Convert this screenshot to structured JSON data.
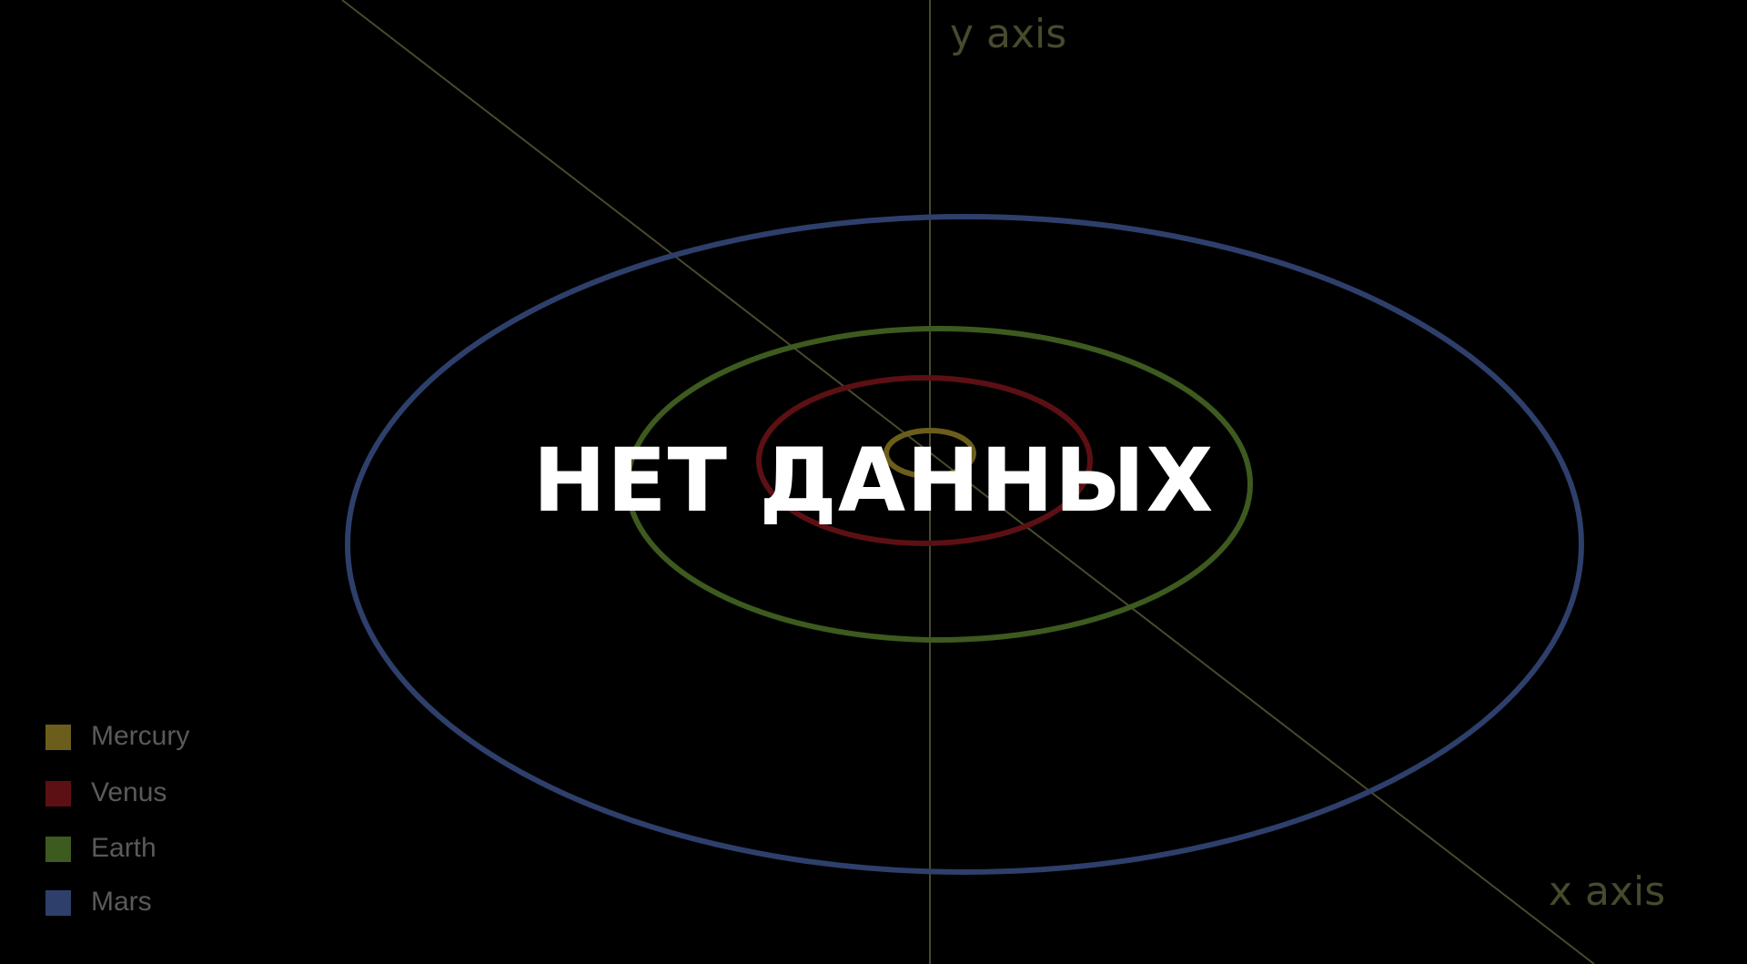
{
  "axes": {
    "y_label": "y axis",
    "x_label": "x axis",
    "color": "#474a2c"
  },
  "overlay": {
    "text": "НЕТ ДАННЫХ",
    "color": "#ffffff"
  },
  "legend": {
    "items": [
      {
        "label": "Mercury",
        "color": "#6b5e1c"
      },
      {
        "label": "Venus",
        "color": "#5c1014"
      },
      {
        "label": "Earth",
        "color": "#3d5a1f"
      },
      {
        "label": "Mars",
        "color": "#2e3f6b"
      }
    ]
  },
  "orbits": [
    {
      "name": "Mercury",
      "color": "#6b5e1c"
    },
    {
      "name": "Venus",
      "color": "#5c1014"
    },
    {
      "name": "Earth",
      "color": "#3d5a1f"
    },
    {
      "name": "Mars",
      "color": "#2e3f6b"
    }
  ]
}
